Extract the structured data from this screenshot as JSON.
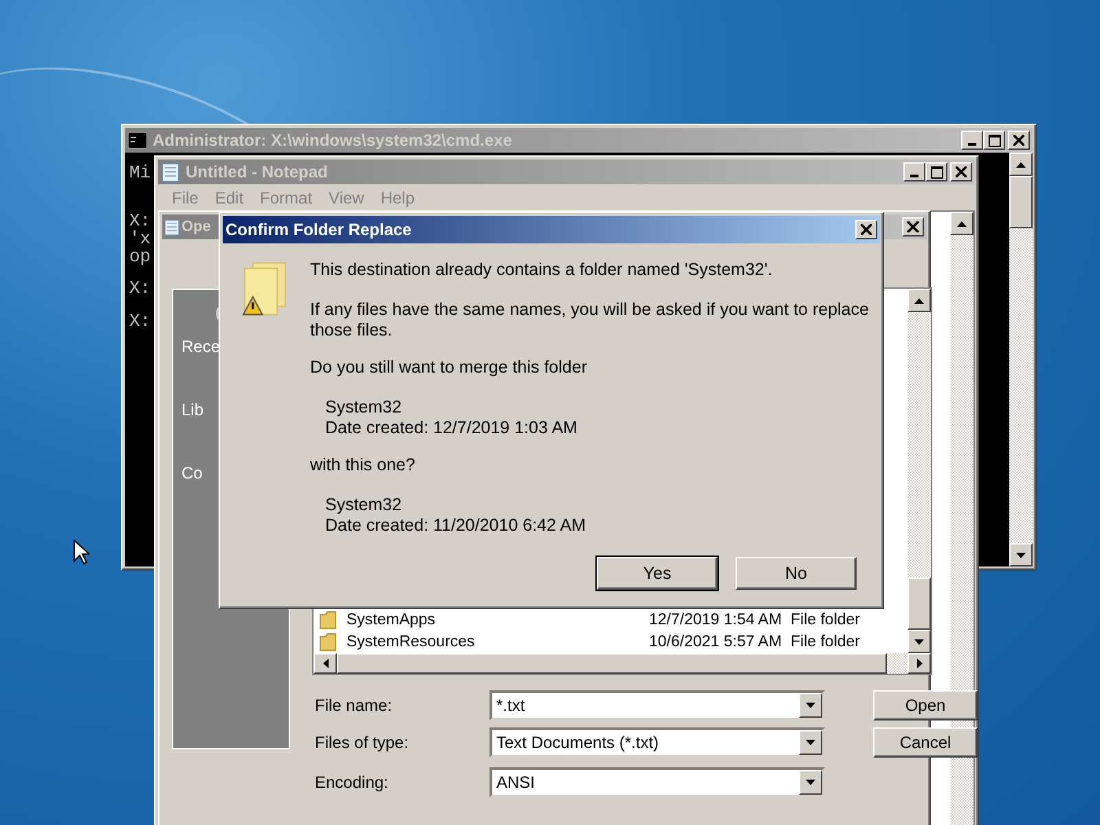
{
  "cmd_window": {
    "title": "Administrator: X:\\windows\\system32\\cmd.exe",
    "console_lines": [
      "Mi",
      "X:",
      "'x",
      "op",
      "X:",
      "X:"
    ]
  },
  "notepad": {
    "title": "Untitled - Notepad",
    "menu": [
      "File",
      "Edit",
      "Format",
      "View",
      "Help"
    ]
  },
  "open_dialog": {
    "title": "Ope",
    "places": [
      "Rece",
      "Lib",
      "Co"
    ],
    "files": [
      {
        "name": "SystemApps",
        "date": "12/7/2019 1:54 AM",
        "type": "File folder"
      },
      {
        "name": "SystemResources",
        "date": "10/6/2021 5:57 AM",
        "type": "File folder"
      }
    ],
    "fields": [
      {
        "label": "File name:",
        "value": "*.txt"
      },
      {
        "label": "Files of type:",
        "value": "Text Documents (*.txt)"
      },
      {
        "label": "Encoding:",
        "value": "ANSI"
      }
    ],
    "buttons": [
      "Open",
      "Cancel"
    ]
  },
  "confirm_dialog": {
    "title": "Confirm Folder Replace",
    "message": "This destination already contains a folder named 'System32'.",
    "detail": "If any files have the same names, you will be asked if you want to replace those files.",
    "question": "Do you still want to merge this folder",
    "existing": {
      "name": "System32",
      "date": "Date created: 12/7/2019 1:03 AM"
    },
    "connector": "with this one?",
    "incoming": {
      "name": "System32",
      "date": "Date created: 11/20/2010 6:42 AM"
    },
    "buttons": [
      {
        "label": "Yes",
        "selected": true
      },
      {
        "label": "No",
        "selected": false
      }
    ]
  }
}
